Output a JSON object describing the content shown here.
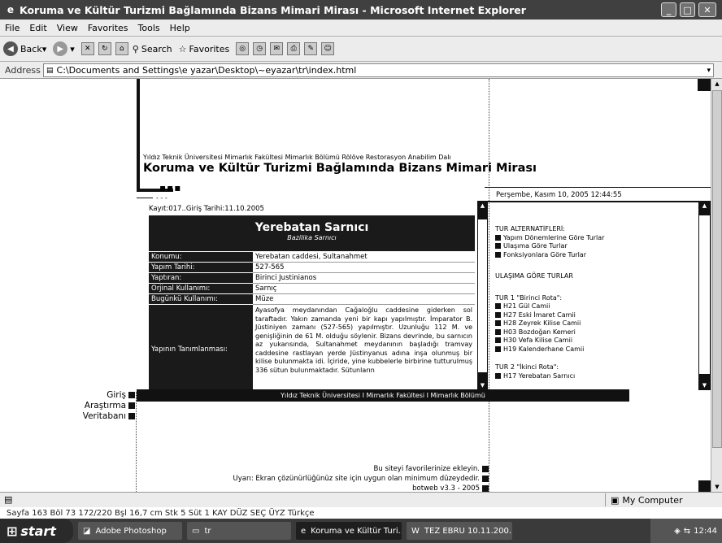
{
  "window": {
    "title": "Koruma ve Kültür Turizmi Bağlamında Bizans Mimari Mirası - Microsoft Internet Explorer",
    "icon": "ie-icon",
    "min": "_",
    "max": "□",
    "close": "✕"
  },
  "menu": [
    "File",
    "Edit",
    "View",
    "Favorites",
    "Tools",
    "Help"
  ],
  "toolbar": {
    "back": "Back",
    "search": "Search",
    "favorites": "Favorites"
  },
  "address": {
    "label": "Address",
    "value": "C:\\Documents and Settings\\e yazar\\Desktop\\~eyazar\\tr\\index.html"
  },
  "page": {
    "university_line": "Yıldız Teknik Üniversitesi Mimarlık Fakültesi Mimarlık Bölümü Rölöve Restorasyon Anabilim Dalı",
    "site_title": "Koruma ve Kültür Turizmi Bağlamında Bizans Mimari Mirası",
    "dash_mark": "▪▪▪",
    "small_dash": "- - -",
    "date": "Perşembe, Kasım 10, 2005 12:44:55",
    "record": "Kayıt:017..Giriş Tarihi:11.10.2005",
    "monument": {
      "name": "Yerebatan Sarnıcı",
      "subtitle": "Bazilika Sarnıcı"
    },
    "fields": [
      {
        "k": "Konumu:",
        "v": "Yerebatan caddesi, Sultanahmet"
      },
      {
        "k": "Yapım Tarihi:",
        "v": "527-565"
      },
      {
        "k": "Yaptıran:",
        "v": "Birinci Justinianos"
      },
      {
        "k": "Orjinal Kullanımı:",
        "v": "Sarnıç"
      },
      {
        "k": "Bugünkü Kullanımı:",
        "v": "Müze"
      }
    ],
    "desc_label": "Yapının Tanımlanması:",
    "desc": "Ayasofya meydanından Cağaloğlu caddesine giderken sol taraftadır. Yakın zamanda yeni bir kapı yapılmıştır. İmparator B. Jüstiniyen zamanı (527-565) yapılmıştır. Uzunluğu 112 M. ve genişliğinin de 61 M. olduğu söylenir. Bizans devrinde, bu sarnıcın az yukarısında, Sultanahmet meydanının başladığı tramvay caddesine rastlayan yerde Jüstinyanus adına inşa olunmuş bir kilise bulunmakta idi. İçiride, yine kubbelerle birbirine tutturulmuş 336 sütun bulunmaktadır. Sütunların",
    "footer_bar": "Yıldız Teknik Üniversitesi I Mimarlık Fakültesi I Mimarlık Bölümü",
    "nav": [
      "Giriş",
      "Araştırma",
      "Veritabanı"
    ],
    "right": {
      "alt_title": "TUR ALTERNATİFLERİ:",
      "alts": [
        "Yapım Dönemlerine Göre Turlar",
        "Ulaşıma Göre Turlar",
        "Fonksiyonlara Göre Turlar"
      ],
      "section": "ULAŞIMA GÖRE TURLAR",
      "tour1": "TUR 1 \"Birinci Rota\":",
      "tour1_items": [
        "H21 Gül Camii",
        "H27 Eski İmaret Camii",
        "H28 Zeyrek Kilise Camii",
        "H03 Bozdoğan Kemeri",
        "H30 Vefa Kilise Camii",
        "H19 Kalenderhane Camii"
      ],
      "tour2": "TUR 2 \"İkinci Rota\":",
      "tour2_item": "H17 Yerebatan Sarnıcı"
    },
    "bottom": [
      "Bu siteyi favorilerinize ekleyin.",
      "Uyarı: Ekran çözünürlüğünüz site için uygun olan minimum düzeydedir.",
      "botweb v3.3 - 2005"
    ]
  },
  "status": {
    "zone": "My Computer"
  },
  "word_status": "Sayfa 163   Böl 73   172/220   Bşl 16,7 cm  Stk 5   Süt 1    KAY  DÜZ  SEÇ  ÜYZ    Türkçe",
  "taskbar": {
    "start": "start",
    "tasks": [
      "Adobe Photoshop",
      "tr",
      "Koruma ve Kültür Turi...",
      "TEZ EBRU 10.11.200..."
    ],
    "clock": "12:44"
  }
}
